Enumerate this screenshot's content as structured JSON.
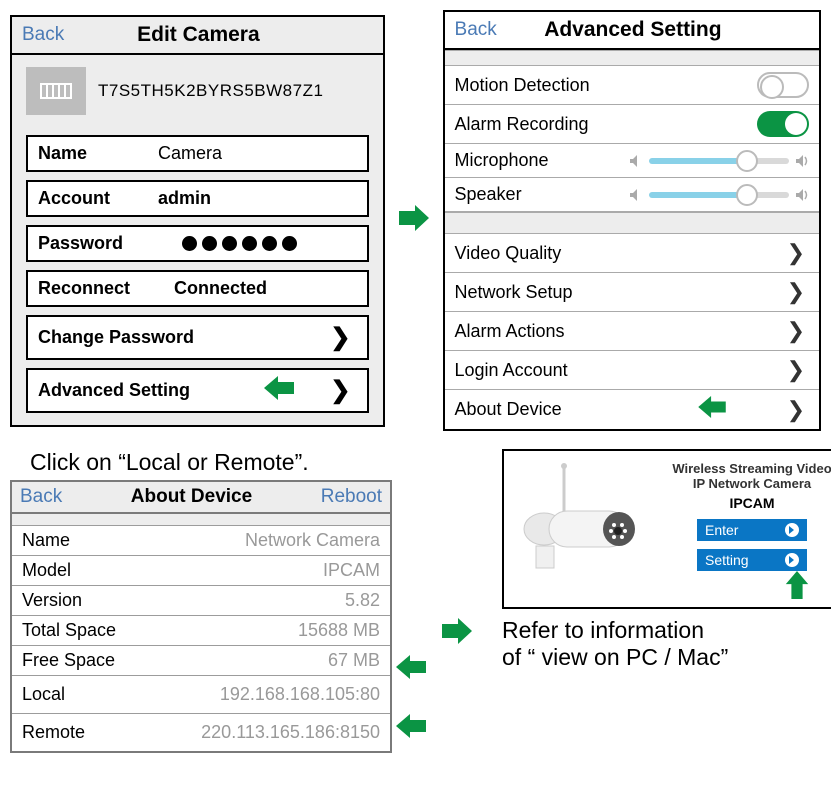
{
  "editCamera": {
    "back": "Back",
    "title": "Edit Camera",
    "cameraId": "T7S5TH5K2BYRS5BW87Z1",
    "name": {
      "label": "Name",
      "value": "Camera"
    },
    "account": {
      "label": "Account",
      "value": "admin"
    },
    "password": {
      "label": "Password"
    },
    "reconnect": {
      "label": "Reconnect",
      "value": "Connected"
    },
    "changePassword": "Change Password",
    "advancedSetting": "Advanced Setting"
  },
  "advanced": {
    "back": "Back",
    "title": "Advanced Setting",
    "motionDetection": "Motion Detection",
    "alarmRecording": "Alarm Recording",
    "microphone": "Microphone",
    "speaker": "Speaker",
    "videoQuality": "Video Quality",
    "networkSetup": "Network Setup",
    "alarmActions": "Alarm Actions",
    "loginAccount": "Login Account",
    "aboutDevice": "About Device"
  },
  "instruction": "Click on “Local or Remote”.",
  "about": {
    "back": "Back",
    "title": "About Device",
    "reboot": "Reboot",
    "rows": {
      "name": {
        "label": "Name",
        "value": "Network Camera"
      },
      "model": {
        "label": "Model",
        "value": "IPCAM"
      },
      "version": {
        "label": "Version",
        "value": "5.82"
      },
      "totalSpace": {
        "label": "Total Space",
        "value": "15688 MB"
      },
      "freeSpace": {
        "label": "Free Space",
        "value": "67 MB"
      },
      "local": {
        "label": "Local",
        "value": "192.168.168.105:80"
      },
      "remote": {
        "label": "Remote",
        "value": "220.113.165.186:8150"
      }
    }
  },
  "web": {
    "title1": "Wireless Streaming Video",
    "title2": "IP Network Camera",
    "model": "IPCAM",
    "enter": "Enter",
    "setting": "Setting"
  },
  "pcText1": "Refer to information",
  "pcText2": "of “ view on PC / Mac”"
}
